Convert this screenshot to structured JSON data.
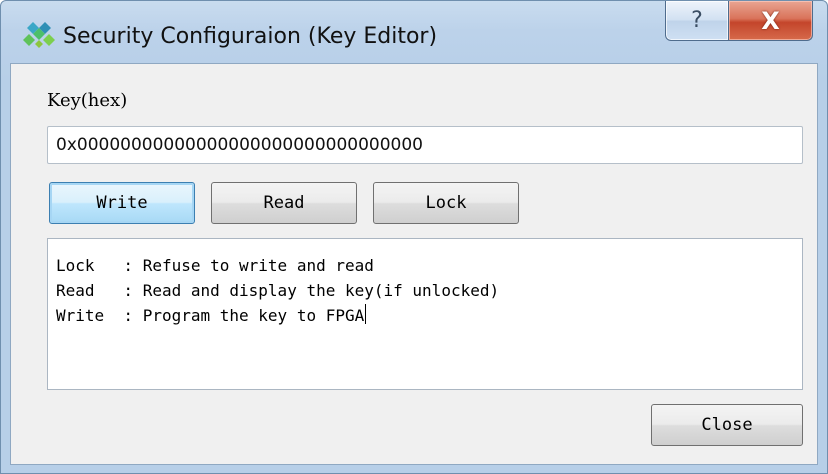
{
  "window": {
    "title": "Security Configuraion (Key Editor)",
    "help_glyph": "?",
    "close_glyph": "X",
    "icon": "app-logo-icon"
  },
  "key": {
    "label": "Key(hex)",
    "value": "0x00000000000000000000000000000000"
  },
  "actions": {
    "write_label": "Write",
    "read_label": "Read",
    "lock_label": "Lock"
  },
  "log": {
    "lines": [
      "Lock   : Refuse to write and read",
      "Read   : Read and display the key(if unlocked)",
      "Write  : Program the key to FPGA"
    ]
  },
  "footer": {
    "close_label": "Close"
  },
  "colors": {
    "title_bar": "#bcd2ea",
    "close_button": "#c4452b",
    "default_button": "#a7d9f5"
  }
}
